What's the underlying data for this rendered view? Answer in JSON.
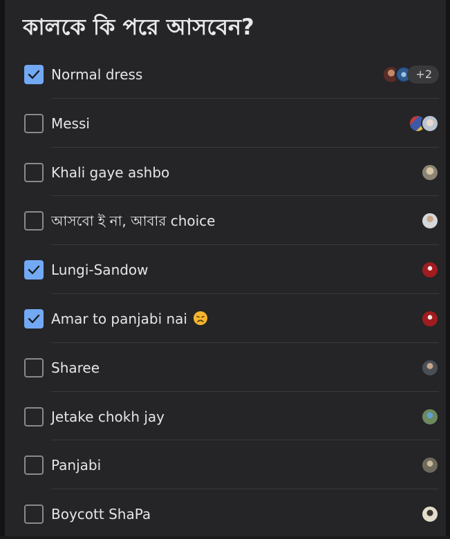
{
  "poll": {
    "title": "কালকে কি পরে আসবেন?",
    "accent_color": "#72a9f5",
    "options": [
      {
        "label": "Normal dress",
        "checked": true,
        "avatars": [
          "#7a4a3a",
          "#3d6b9e"
        ],
        "more": "+2"
      },
      {
        "label": "Messi",
        "checked": false,
        "avatars": [
          "#4b5f9e",
          "#c9d2dc"
        ],
        "more": ""
      },
      {
        "label": "Khali gaye ashbo",
        "checked": false,
        "avatars": [
          "#a49a86"
        ],
        "more": ""
      },
      {
        "label": "আসবো ই না, আবার choice",
        "checked": false,
        "avatars": [
          "#b9bcbf"
        ],
        "more": ""
      },
      {
        "label": "Lungi-Sandow",
        "checked": true,
        "avatars": [
          "#9a1a1c"
        ],
        "more": ""
      },
      {
        "label": "Amar to panjabi nai",
        "checked": true,
        "avatars": [
          "#9a1a1c"
        ],
        "more": "",
        "emoji": "disappointed-face-icon"
      },
      {
        "label": "Sharee",
        "checked": false,
        "avatars": [
          "#5c6166"
        ],
        "more": ""
      },
      {
        "label": "Jetake chokh jay",
        "checked": false,
        "avatars": [
          "#6f8a6a"
        ],
        "more": ""
      },
      {
        "label": "Panjabi",
        "checked": false,
        "avatars": [
          "#7b7768"
        ],
        "more": ""
      },
      {
        "label": "Boycott ShaPa",
        "checked": false,
        "avatars": [
          "#c7c1b0"
        ],
        "more": ""
      }
    ]
  }
}
